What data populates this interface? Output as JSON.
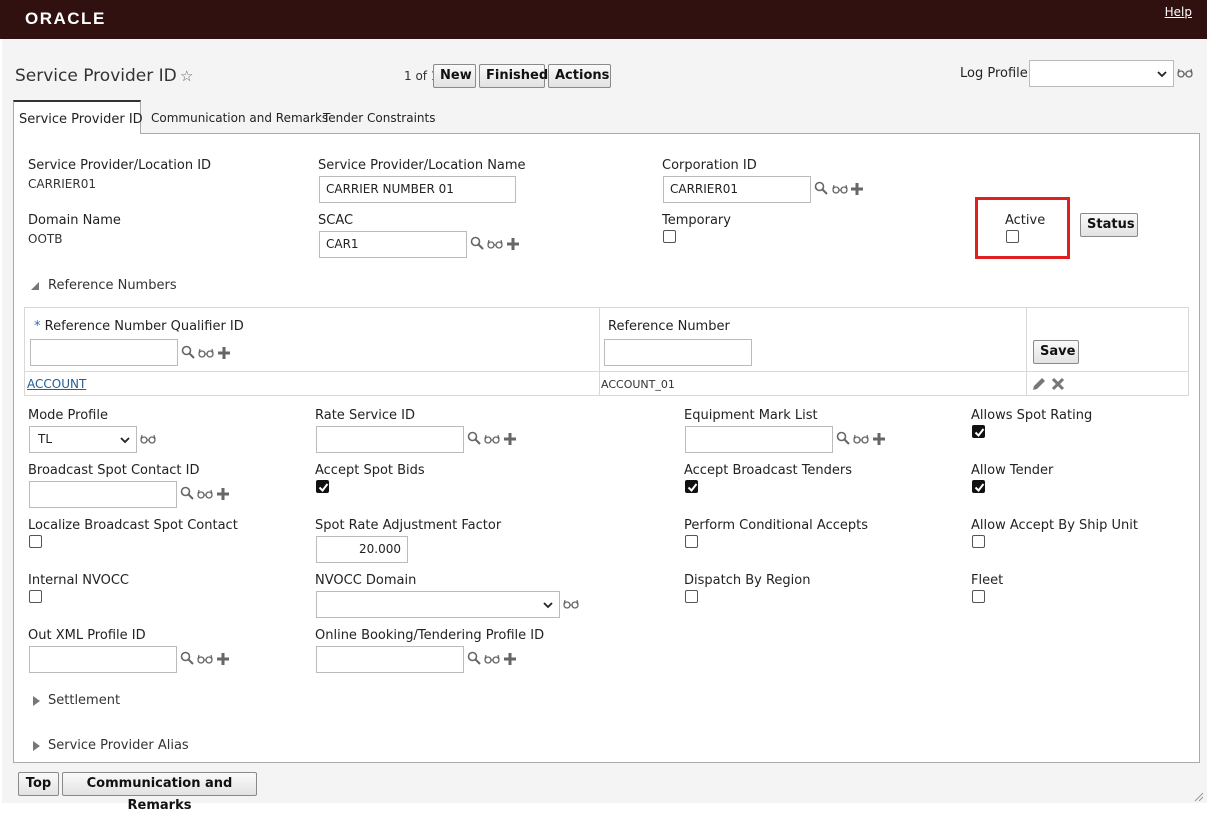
{
  "header": {
    "logo": "ORACLE",
    "help_link": "Help"
  },
  "page": {
    "title": "Service Provider ID",
    "pager": "1 of 1"
  },
  "toolbar": {
    "new_label": "New",
    "finished_label": "Finished",
    "actions_label": "Actions"
  },
  "log_profile": {
    "label": "Log Profile",
    "value": ""
  },
  "tabs": [
    {
      "label": "Service Provider ID",
      "active": true
    },
    {
      "label": "Communication and Remarks",
      "active": false
    },
    {
      "label": "Tender Constraints",
      "active": false
    }
  ],
  "form": {
    "sp_location_id": {
      "label": "Service Provider/Location ID",
      "value": "CARRIER01"
    },
    "sp_location_name": {
      "label": "Service Provider/Location Name",
      "value": "CARRIER NUMBER 01"
    },
    "corporation_id": {
      "label": "Corporation ID",
      "value": "CARRIER01"
    },
    "domain_name": {
      "label": "Domain Name",
      "value": "OOTB"
    },
    "scac": {
      "label": "SCAC",
      "value": "CAR1"
    },
    "temporary": {
      "label": "Temporary",
      "checked": false
    },
    "active": {
      "label": "Active",
      "checked": false
    },
    "status_button": "Status"
  },
  "reference_numbers": {
    "section_label": "Reference Numbers",
    "qualifier_header": "Reference Number Qualifier ID",
    "required_mark": "*",
    "number_header": "Reference Number",
    "save_label": "Save",
    "rows": [
      {
        "qualifier": "ACCOUNT",
        "number": "ACCOUNT_01"
      }
    ]
  },
  "fields": {
    "mode_profile": {
      "label": "Mode Profile",
      "value": "TL"
    },
    "rate_service_id": {
      "label": "Rate Service ID",
      "value": ""
    },
    "equipment_mark_list": {
      "label": "Equipment Mark List",
      "value": ""
    },
    "allows_spot_rating": {
      "label": "Allows Spot Rating",
      "checked": true
    },
    "broadcast_spot_contact_id": {
      "label": "Broadcast Spot Contact ID",
      "value": ""
    },
    "accept_spot_bids": {
      "label": "Accept Spot Bids",
      "checked": true
    },
    "accept_broadcast_tenders": {
      "label": "Accept Broadcast Tenders",
      "checked": true
    },
    "allow_tender": {
      "label": "Allow Tender",
      "checked": true
    },
    "localize_broadcast_spot_contact": {
      "label": "Localize Broadcast Spot Contact",
      "checked": false
    },
    "spot_rate_adjustment_factor": {
      "label": "Spot Rate Adjustment Factor",
      "value": "20.000"
    },
    "perform_conditional_accepts": {
      "label": "Perform Conditional Accepts",
      "checked": false
    },
    "allow_accept_by_ship_unit": {
      "label": "Allow Accept By Ship Unit",
      "checked": false
    },
    "internal_nvocc": {
      "label": "Internal NVOCC",
      "checked": false
    },
    "nvocc_domain": {
      "label": "NVOCC Domain",
      "value": ""
    },
    "dispatch_by_region": {
      "label": "Dispatch By Region",
      "checked": false
    },
    "fleet": {
      "label": "Fleet",
      "checked": false
    },
    "out_xml_profile_id": {
      "label": "Out XML Profile ID",
      "value": ""
    },
    "online_booking_profile_id": {
      "label": "Online Booking/Tendering Profile ID",
      "value": ""
    }
  },
  "sections": {
    "settlement": "Settlement",
    "service_provider_alias": "Service Provider Alias"
  },
  "footer": {
    "top_label": "Top",
    "comm_label": "Communication and Remarks"
  }
}
